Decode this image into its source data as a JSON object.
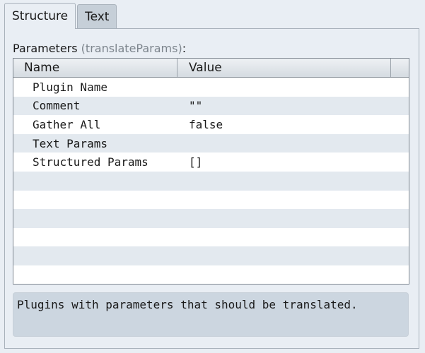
{
  "tabs": [
    {
      "label": "Structure",
      "active": true
    },
    {
      "label": "Text",
      "active": false
    }
  ],
  "parameters": {
    "label": "Parameters",
    "param_name": "(translateParams)",
    "suffix": ":"
  },
  "table": {
    "columns": [
      "Name",
      "Value"
    ],
    "rows": [
      {
        "name": "Plugin Name",
        "value": ""
      },
      {
        "name": "Comment",
        "value": "\"\""
      },
      {
        "name": "Gather All",
        "value": "false"
      },
      {
        "name": "Text Params",
        "value": ""
      },
      {
        "name": "Structured Params",
        "value": "[]"
      },
      {
        "name": "",
        "value": ""
      },
      {
        "name": "",
        "value": ""
      },
      {
        "name": "",
        "value": ""
      },
      {
        "name": "",
        "value": ""
      },
      {
        "name": "",
        "value": ""
      },
      {
        "name": "",
        "value": ""
      }
    ]
  },
  "description": {
    "text": "Plugins with parameters that should be translated."
  },
  "colors": {
    "background": "#e9eef4",
    "row_alt": "#e3e9ef",
    "description_bg": "#ccd6e0",
    "tab_inactive": "#c6cfd8"
  }
}
